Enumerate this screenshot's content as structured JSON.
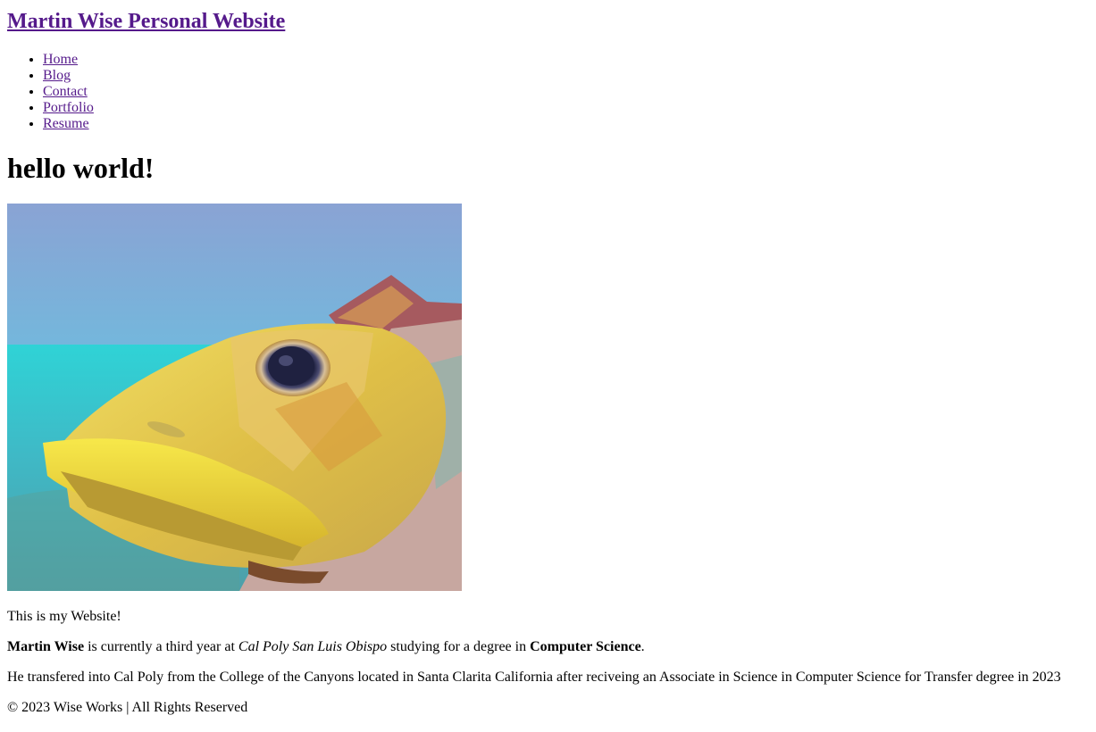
{
  "site": {
    "title": "Martin Wise Personal Website"
  },
  "nav": {
    "items": [
      {
        "label": "Home"
      },
      {
        "label": "Blog"
      },
      {
        "label": "Contact"
      },
      {
        "label": "Portfolio"
      },
      {
        "label": "Resume"
      }
    ]
  },
  "main": {
    "heading": "hello world!",
    "image_subject": "fish-image",
    "intro": "This is my Website!",
    "bio": {
      "name": "Martin Wise",
      "text1": " is currently a third year at ",
      "school": "Cal Poly San Luis Obispo",
      "text2": " studying for a degree in ",
      "degree": "Computer Science",
      "text3": "."
    },
    "transfer": "He transfered into Cal Poly from the College of the Canyons located in Santa Clarita California after reciveing an Associate in Science in Computer Science for Transfer degree in 2023"
  },
  "footer": {
    "copyright": "© 2023 Wise Works | All Rights Reserved"
  },
  "colors": {
    "link": "#551a8b",
    "text": "#000000",
    "background": "#ffffff"
  }
}
